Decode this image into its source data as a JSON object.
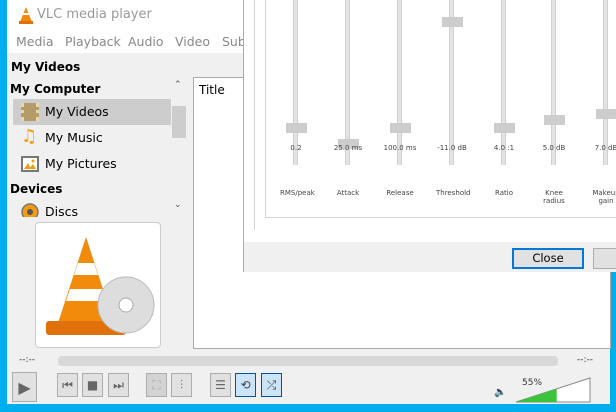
{
  "window": {
    "title": "VLC media player"
  },
  "menu": [
    "Media",
    "Playback",
    "Audio",
    "Video",
    "Sub"
  ],
  "sidebar": {
    "top": "My Videos",
    "section_computer": "My Computer",
    "items": [
      {
        "label": "My Videos",
        "icon": "film-icon",
        "selected": true
      },
      {
        "label": "My Music",
        "icon": "music-note-icon"
      },
      {
        "label": "My Pictures",
        "icon": "picture-icon"
      }
    ],
    "section_devices": "Devices",
    "devices": [
      {
        "label": "Discs",
        "icon": "disc-icon"
      }
    ]
  },
  "playlist": {
    "column_title": "Title"
  },
  "compressor": {
    "sliders": [
      {
        "value": "0.2",
        "label": "RMS/peak",
        "level": 0.2
      },
      {
        "value": "25.0 ms",
        "label": "Attack",
        "level": 0.1
      },
      {
        "value": "100.0 ms",
        "label": "Release",
        "level": 0.2
      },
      {
        "value": "-11.0 dB",
        "label": "Threshold",
        "level": 0.86
      },
      {
        "value": "4.0 :1",
        "label": "Ratio",
        "level": 0.2
      },
      {
        "value": "5.0 dB",
        "label": "Knee radius",
        "level": 0.25
      },
      {
        "value": "7.0 dB",
        "label": "Makeup gain",
        "level": 0.29
      }
    ],
    "close_label": "Close"
  },
  "player": {
    "elapsed": "--:--",
    "remaining": "--:--",
    "volume": "55%",
    "volume_level": 0.55,
    "accent": "#3bc43b"
  }
}
